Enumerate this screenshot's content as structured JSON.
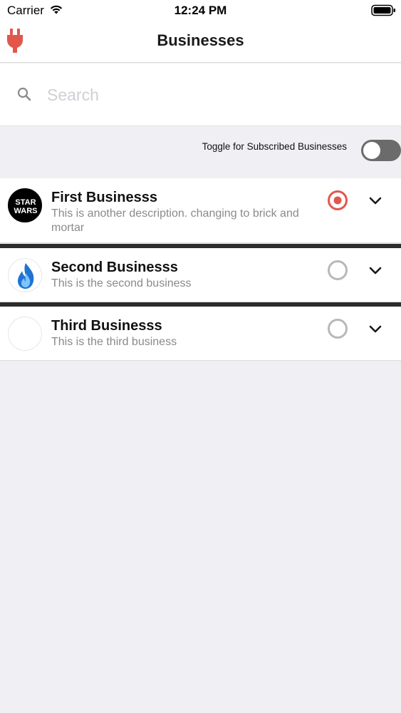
{
  "status_bar": {
    "carrier": "Carrier",
    "time": "12:24 PM",
    "icons": [
      "wifi-icon",
      "battery-icon"
    ]
  },
  "nav": {
    "title": "Businesses",
    "left_icon": "plug-icon",
    "accent_color": "#e2574c"
  },
  "search": {
    "placeholder": "Search",
    "value": ""
  },
  "filter": {
    "toggle_label": "Toggle for Subscribed Businesses",
    "toggle_on": false
  },
  "businesses": [
    {
      "name": "First Businesss",
      "description": "This is another description. changing to brick and mortar",
      "logo": "star-wars-logo",
      "subscribed": true
    },
    {
      "name": "Second Businesss",
      "description": "This is the second business",
      "logo": "blue-flame-logo",
      "subscribed": false
    },
    {
      "name": "Third Businesss",
      "description": "This is the third business",
      "logo": "blank-logo",
      "subscribed": false
    }
  ],
  "colors": {
    "subscribed": "#e2574c",
    "unsubscribed": "#b8b8b8",
    "background": "#efeff4"
  }
}
